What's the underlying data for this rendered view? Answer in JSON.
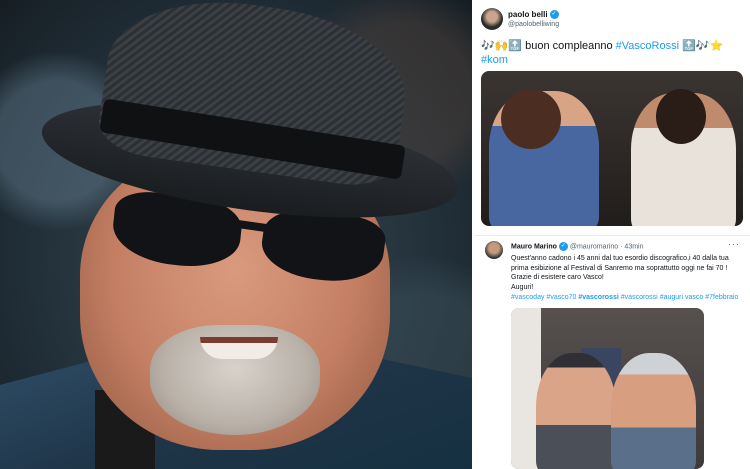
{
  "tweet1": {
    "display_name": "paolo belli",
    "handle": "@paolobelliwing",
    "text_prefix": "🎶🙌🔝 buon compleanno ",
    "hashtag_main": "#VascoRossi",
    "text_suffix": " 🔝🎶⭐",
    "hashtag_second": "#kom"
  },
  "tweet2": {
    "display_name": "Mauro Marino",
    "handle": "@mauromarino",
    "separator": " · ",
    "time": "43min",
    "more": "···",
    "text": "Quest'anno cadono i 45 anni dal tuo esordio discografico,i 40 dalla tua prima esibizione al Festival di Sanremo ma soprattutto oggi ne fai 70 ! Grazie di esistere caro Vasco!",
    "text_end": "Auguri!",
    "hashtags": [
      "#vascoday",
      "#vasco70",
      "#vascorossi",
      "#vascorossi",
      "#auguri vasco",
      "#7febbraio"
    ]
  },
  "colors": {
    "link": "#1d9bf0",
    "text": "#0f1419",
    "muted": "#536471"
  },
  "icons": {
    "verified": "verified-badge-icon"
  }
}
